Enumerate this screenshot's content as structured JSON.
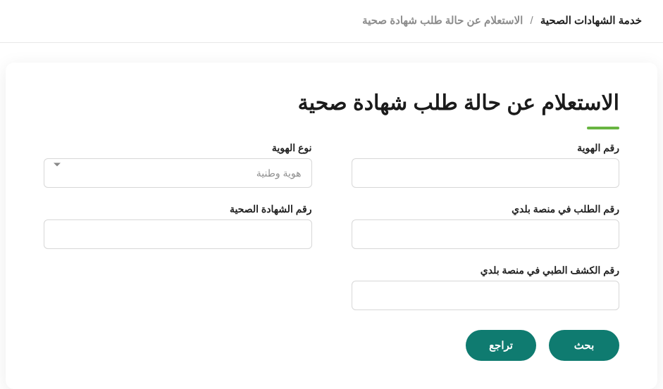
{
  "breadcrumb": {
    "root": "خدمة الشهادات الصحية",
    "separator": "/",
    "current": "الاستعلام عن حالة طلب شهادة صحية"
  },
  "title": "الاستعلام عن حالة طلب شهادة صحية",
  "fields": {
    "id_number": {
      "label": "رقم الهوية",
      "value": ""
    },
    "id_type": {
      "label": "نوع الهوية",
      "selected": "هوية وطنية"
    },
    "balady_req": {
      "label": "رقم الطلب في منصة بلدي",
      "value": ""
    },
    "cert_number": {
      "label": "رقم الشهادة الصحية",
      "value": ""
    },
    "med_exam": {
      "label": "رقم الكشف الطبي في منصة بلدي",
      "value": ""
    }
  },
  "actions": {
    "search": "بحث",
    "reset": "تراجع"
  },
  "colors": {
    "accent": "#68b541",
    "primary": "#0f7b70"
  }
}
